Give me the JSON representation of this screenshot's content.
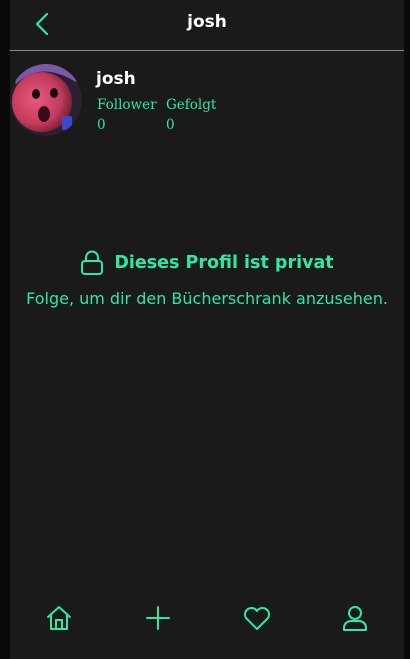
{
  "header": {
    "title": "josh",
    "back_icon": "chevron-left-icon"
  },
  "profile": {
    "name": "josh",
    "stats": [
      {
        "label": "Follower",
        "value": "0"
      },
      {
        "label": "Gefolgt",
        "value": "0"
      }
    ]
  },
  "private": {
    "icon": "lock-icon",
    "title": "Dieses Profil ist privat",
    "message": "Folge, um dir den Bücherschrank anzusehen."
  },
  "nav": {
    "items": [
      "home-icon",
      "plus-icon",
      "heart-icon",
      "user-icon"
    ]
  },
  "colors": {
    "accent": "#2ee8a4",
    "background": "#1a1a1a",
    "outer": "#0a0a0a"
  }
}
